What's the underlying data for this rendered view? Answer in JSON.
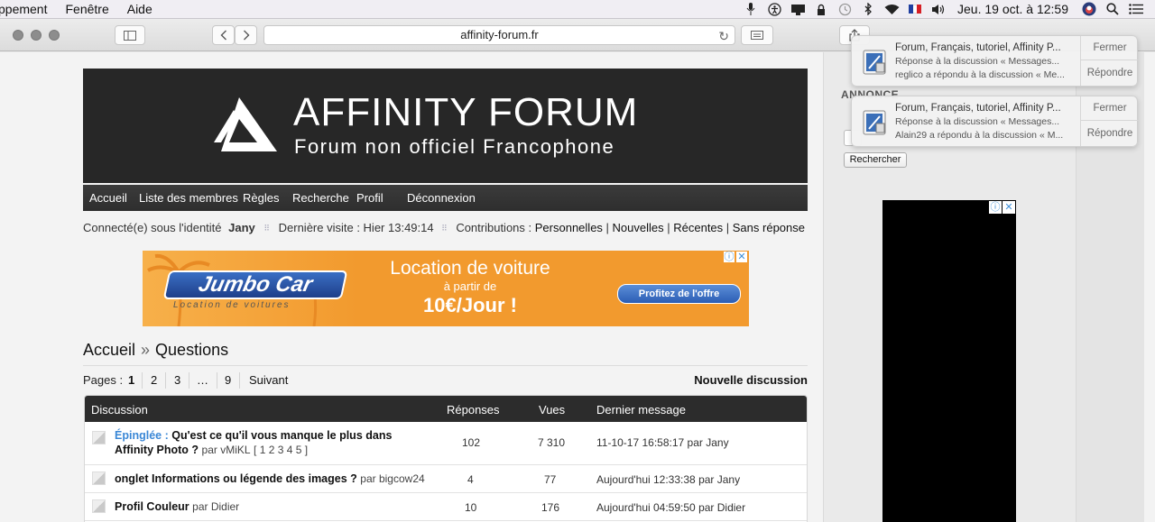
{
  "menubar": {
    "items": [
      "ppement",
      "Fenêtre",
      "Aide"
    ],
    "clock": "Jeu. 19 oct. à  12:59",
    "icons": [
      "mic-icon",
      "accessibility-icon",
      "display-icon",
      "lock-icon",
      "time-machine-icon",
      "bluetooth-icon",
      "wifi-icon",
      "flag-fr-icon",
      "volume-icon",
      "user-avatar-icon",
      "search-icon",
      "list-icon"
    ]
  },
  "browser": {
    "url": "affinity-forum.fr"
  },
  "banner": {
    "title": "AFFINITY  FORUM",
    "subtitle": "Forum non officiel Francophone"
  },
  "nav": {
    "items": [
      "Accueil",
      "Liste des membres",
      "Règles",
      "Recherche",
      "Profil",
      "Déconnexion"
    ]
  },
  "userbar": {
    "prefix": "Connecté(e) sous l'identité",
    "user": "Jany",
    "last_visit": "Dernière visite : Hier 13:49:14",
    "contrib_label": "Contributions :",
    "contrib_links": [
      "Personnelles",
      "Nouvelles",
      "Récentes",
      "Sans réponse"
    ]
  },
  "ad": {
    "brand": "Jumbo Car",
    "slogan": "Location de voitures",
    "headline": "Location de voiture",
    "sub": "à partir de",
    "price": "10€/Jour !",
    "cta": "Profitez de l'offre"
  },
  "breadcrumb": {
    "home": "Accueil",
    "sep": "»",
    "current": "Questions"
  },
  "pagination": {
    "label": "Pages :",
    "pages": [
      "1",
      "2",
      "3",
      "…",
      "9"
    ],
    "current": "1",
    "next": "Suivant",
    "new_discussion": "Nouvelle discussion"
  },
  "table": {
    "headers": [
      "Discussion",
      "Réponses",
      "Vues",
      "Dernier message"
    ],
    "rows": [
      {
        "pinned_label": "Épinglée :",
        "title_line1": "Qu'est ce qu'il vous manque le plus dans",
        "title_line2": "Affinity Photo ?",
        "by": "par vMiKL",
        "pages": "[ 1 2 3 4 5 ]",
        "replies": "102",
        "views": "7 310",
        "last": "11-10-17 16:58:17",
        "last_by": "par Jany"
      },
      {
        "title": "onglet Informations ou légende des images ?",
        "by": "par bigcow24",
        "replies": "4",
        "views": "77",
        "last": "Aujourd'hui 12:33:38",
        "last_by": "par Jany"
      },
      {
        "title": "Profil Couleur",
        "by": "par Didier",
        "replies": "10",
        "views": "176",
        "last": "Aujourd'hui 04:59:50",
        "last_by": "par Didier"
      }
    ]
  },
  "sidebar": {
    "annonce": "ANNONCE",
    "search_button": "Rechercher"
  },
  "notifications": [
    {
      "title": "Forum, Français, tutoriel, Affinity P...",
      "line1": "Réponse à la discussion « Messages...",
      "line2": "reglico a répondu à la discussion « Me...",
      "close": "Fermer",
      "reply": "Répondre"
    },
    {
      "title": "Forum, Français, tutoriel, Affinity P...",
      "line1": "Réponse à la discussion « Messages...",
      "line2": "Alain29 a répondu à la discussion « M...",
      "close": "Fermer",
      "reply": "Répondre"
    }
  ]
}
